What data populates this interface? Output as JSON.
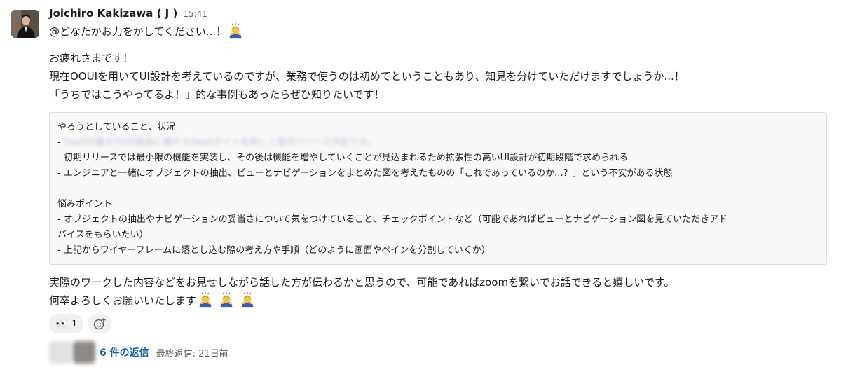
{
  "message": {
    "sender": "Joichiro Kakizawa ( J )",
    "time": "15:41",
    "mention_line": "@どなたかお力をかしてください...！",
    "greeting": "お疲れさまです！",
    "body_line_1": "現在OOUIを用いてUI設計を考えているのですが、業務で使うのは初めてということもあり、知見を分けていただけますでしょうか...！",
    "body_line_2": "「うちではこうやってるよ！」的な事例もあったらぜひ知りたいです！",
    "code_block": {
      "heading_1": "やろうとしていること、状況",
      "item_1_prefix": "- ",
      "item_1_blurred": "SaaSの最大やOS製品に関するSaaSサイトを新しく各月リリース予定です。",
      "item_2": "- 初期リリースでは最小限の機能を実装し、その後は機能を増やしていくことが見込まれるため拡張性の高いUI設計が初期段階で求められる",
      "item_3": "- エンジニアと一緒にオブジェクトの抽出、ビューとナビゲーションをまとめた図を考えたものの「これであっているのか...？」という不安がある状態",
      "heading_2": "悩みポイント",
      "item_4a": "- オブジェクトの抽出やナビゲーションの妥当さについて気をつけていること、チェックポイントなど（可能であればビューとナビゲーション図を見ていただきアド",
      "item_4b": "バイスをもらいたい）",
      "item_5": "- 上記からワイヤーフレームに落とし込む際の考え方や手順（どのように画面やペインを分割していくか）"
    },
    "closing_line_1": "実際のワークした内容などをお見せしながら話した方が伝わるかと思うので、可能であればzoomを繋いでお話できると嬉しいです。",
    "closing_line_2": "何卒よろしくお願いいたします"
  },
  "emoji": {
    "mention": "bowing-person",
    "closing": [
      "bowing-person",
      "bowing-person",
      "bowing-person"
    ]
  },
  "reactions": [
    {
      "emoji": "eyes",
      "glyph": "👀",
      "count": "1"
    }
  ],
  "add_reaction_icon": "add-reaction-icon",
  "thread": {
    "reply_count": "6 件の返信",
    "last_reply": "最終返信: 21日前"
  },
  "colors": {
    "link": "#1264a3",
    "muted": "#616061",
    "code_bg": "#f8f8f8",
    "code_border": "#dddddd",
    "reaction_bg": "#f0f0f0"
  }
}
